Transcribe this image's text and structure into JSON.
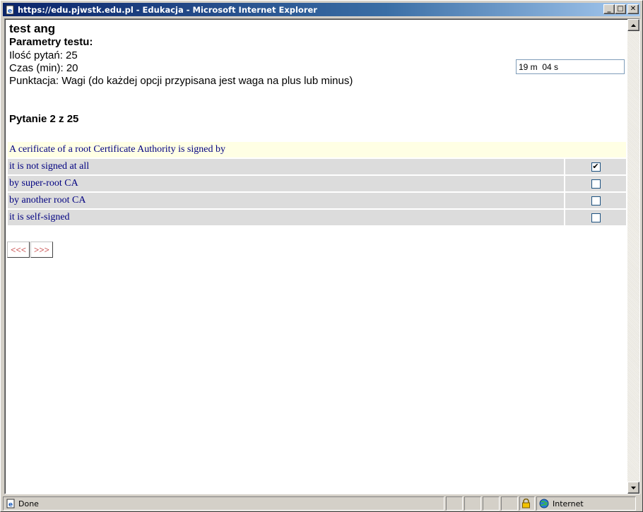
{
  "window": {
    "title": "https://edu.pjwstk.edu.pl - Edukacja - Microsoft Internet Explorer",
    "icon": "ie-page-icon",
    "controls": {
      "minimize": "_",
      "maximize": "□",
      "close": "✕"
    }
  },
  "test": {
    "title": "test ang",
    "params_heading": "Parametry testu:",
    "question_count": "Ilość pytań: 25",
    "time": "Czas (min): 20",
    "scoring": "Punktacja: Wagi (do każdej opcji przypisana jest waga na plus lub minus)",
    "timer_value": "19 m  04 s"
  },
  "question": {
    "number_label": "Pytanie 2 z 25",
    "text": "A cerificate of a root Certificate Authority is signed by",
    "answers": [
      {
        "label": "it is not signed at all",
        "checked": true
      },
      {
        "label": "by super-root CA",
        "checked": false
      },
      {
        "label": "by another root CA",
        "checked": false
      },
      {
        "label": "it is self-signed",
        "checked": false
      }
    ]
  },
  "nav": {
    "prev": "<<<",
    "next": ">>>"
  },
  "status": {
    "text": "Done",
    "zone": "Internet"
  }
}
